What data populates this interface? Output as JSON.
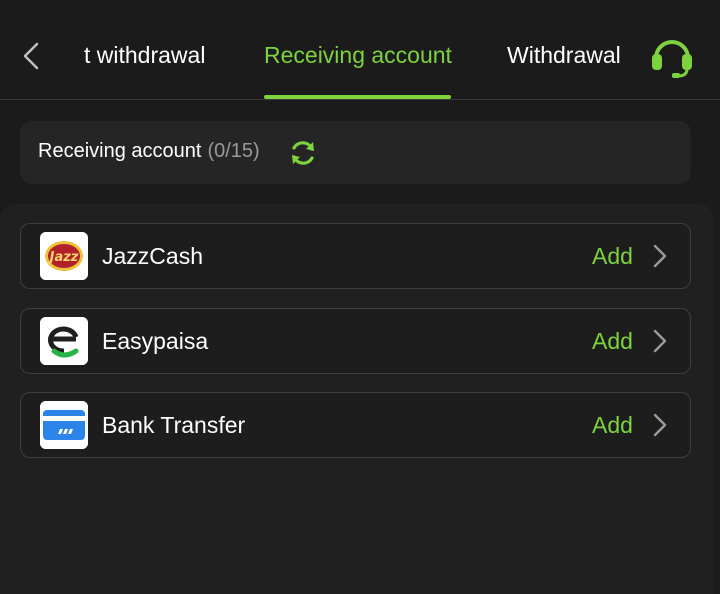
{
  "header": {
    "tabs": [
      {
        "label": "t withdrawal",
        "active": false
      },
      {
        "label": "Receiving account",
        "active": true
      },
      {
        "label": "Withdrawal",
        "active": false
      }
    ],
    "back_icon": "chevron-left-icon",
    "support_icon": "headset-icon"
  },
  "summary": {
    "label": "Receiving account",
    "count": "(0/15)",
    "refresh_icon": "refresh-icon"
  },
  "accounts": [
    {
      "name": "JazzCash",
      "action": "Add",
      "icon": "jazzcash-logo"
    },
    {
      "name": "Easypaisa",
      "action": "Add",
      "icon": "easypaisa-logo"
    },
    {
      "name": "Bank Transfer",
      "action": "Add",
      "icon": "bank-card-icon"
    }
  ],
  "colors": {
    "accent": "#7cd33d",
    "background": "#1b1b1b",
    "card": "#252525"
  },
  "logos": {
    "jazzcash_text": "Jazz"
  }
}
